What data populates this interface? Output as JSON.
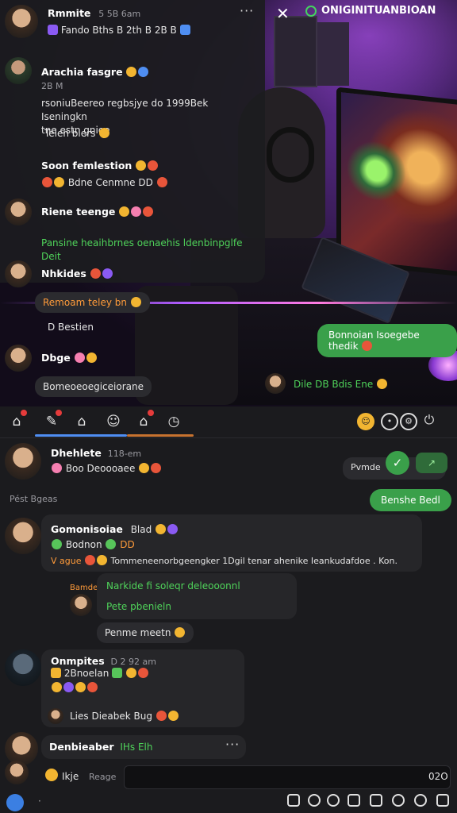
{
  "scene": {
    "brand": "ONIGINITUANBIOAN",
    "close_label": "✕"
  },
  "overlay": {
    "header": {
      "name": "Rmmite",
      "time": "5 5B 6am",
      "sub": "Fando  Bths  B  2th B  2B  B"
    },
    "msg1": {
      "name": "Arachia fasgre",
      "time": "2B M",
      "line1": "rsoniuBeereo regbsjye do 1999Bek Iseningkn",
      "line2": "tne estn gnioe",
      "line3": "Telen blers"
    },
    "msg2": {
      "name": "Soon femlestion",
      "reacts": "Bdne  Cenmne  DD"
    },
    "msg3": {
      "name": "Riene teenge",
      "line1": "Pansine heaihbrnes oenaehis ldenbinpglfe",
      "line2": "Deit"
    },
    "msg4": {
      "name": "Nhkides"
    },
    "pill1": "Remoam teley bn",
    "label1": "D  Bestien",
    "msg5": {
      "name": "Dbge"
    },
    "pill2": "Bomeoeoegiceiorane",
    "green_bubble": "Bonnoian Isoegebe thedik",
    "footer_label": "Dile  DB  Bdis  Ene"
  },
  "tabbar": {
    "tabs": [
      "home",
      "chat",
      "home2",
      "emoji",
      "home3",
      "clock"
    ],
    "right": [
      "smile",
      "circle",
      "settings",
      "power"
    ]
  },
  "feed": {
    "item1": {
      "name": "Dhehlete",
      "time": "118-em",
      "reacts": "Boo  Deoooaee"
    },
    "date_label": "Pést  Bgeas",
    "right_pill": "Pvmde",
    "right_green": "Benshe Bedl",
    "item2": {
      "name": "Gomonisoiae",
      "tag": "Blad",
      "sub": "Bodnon",
      "line": "Tommeneenorbgeengker 1Dgil tenar ahenike Ieankudafdoe . Kon.",
      "vague": "V ague"
    },
    "reply": {
      "who": "Bamde",
      "line1": "Narkide fi soleqr deleooonnl",
      "line2": "Pete pbenieln"
    },
    "pill": "Penme meetn",
    "item3": {
      "name": "Onmpites",
      "time": "D 2 92 am",
      "sub": "2Bnoelan",
      "line2": "Lies Dieabek  Bug"
    },
    "item4": {
      "name": "Denbieaber",
      "tag": "IHs  Elh"
    }
  },
  "composer": {
    "label": "Ikje",
    "placeholder": "Reage",
    "count": "02O"
  }
}
